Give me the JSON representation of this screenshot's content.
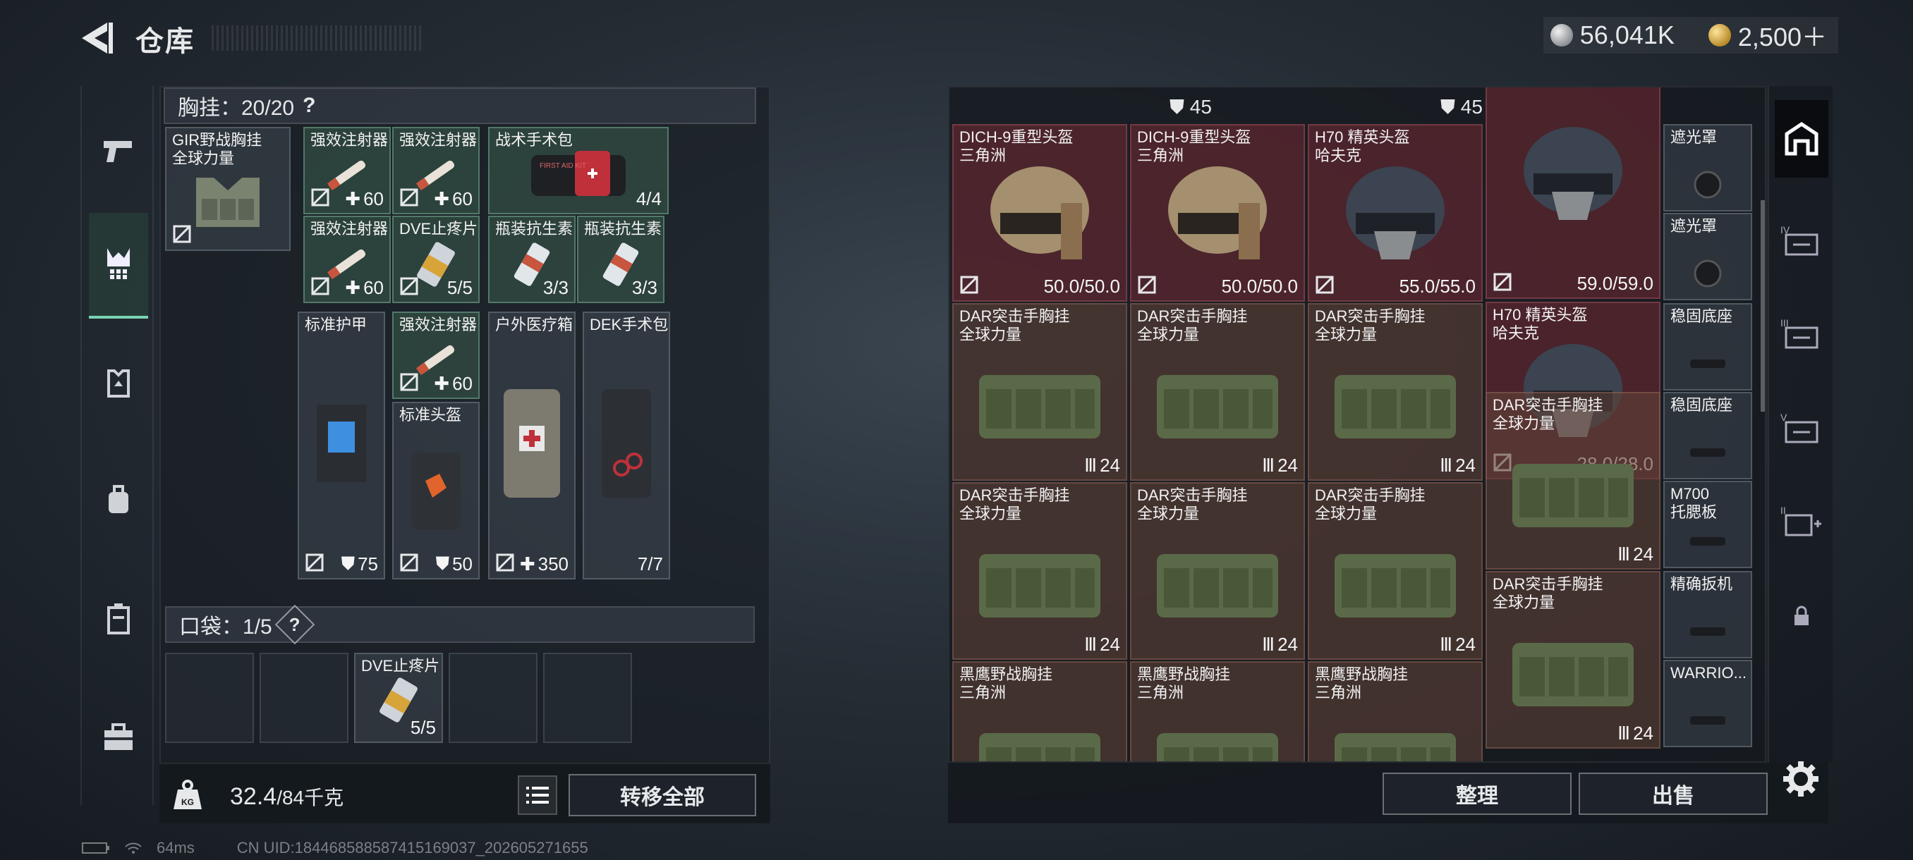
{
  "header": {
    "title": "仓库"
  },
  "currency": {
    "coins": "56,041K",
    "gold": "2,500＋"
  },
  "chest_rig": {
    "label": "胸挂：",
    "count": "20/20",
    "help": "?"
  },
  "pocket": {
    "label": "口袋：",
    "count": "1/5",
    "help": "?"
  },
  "left_items": {
    "rig": {
      "name": "GIR野战胸挂\n全球力量"
    },
    "s1": {
      "name": "强效注射器",
      "value": "60"
    },
    "s2": {
      "name": "强效注射器",
      "value": "60"
    },
    "kit": {
      "name": "战术手术包",
      "value": "4/4",
      "label": "FIRST AID KIT"
    },
    "s3": {
      "name": "强效注射器",
      "value": "60"
    },
    "dve": {
      "name": "DVE止疼片",
      "value": "5/5"
    },
    "ab1": {
      "name": "瓶装抗生素",
      "value": "3/3"
    },
    "ab2": {
      "name": "瓶装抗生素",
      "value": "3/3"
    },
    "armor": {
      "name": "标准护甲",
      "value": "75"
    },
    "s4": {
      "name": "强效注射器",
      "value": "60"
    },
    "helmet": {
      "name": "标准头盔",
      "value": "50"
    },
    "medbox": {
      "name": "户外医疗箱",
      "value": "350"
    },
    "dek": {
      "name": "DEK手术包",
      "value": "7/7"
    },
    "pocket_dve": {
      "name": "DVE止疼片",
      "value": "5/5"
    }
  },
  "weight": {
    "value": "32.4",
    "max": "/84千克",
    "icon_text": "KG"
  },
  "buttons": {
    "transfer_all": "转移全部",
    "organize": "整理",
    "sell": "出售"
  },
  "right_top_values": [
    "45",
    "45"
  ],
  "right_grid": [
    {
      "name": "DICH-9重型头盔\n三角洲",
      "value": "50.0/50.0",
      "color": "red"
    },
    {
      "name": "DICH-9重型头盔\n三角洲",
      "value": "50.0/50.0",
      "color": "red"
    },
    {
      "name": "H70 精英头盔\n哈夫克",
      "value": "55.0/55.0",
      "color": "red"
    },
    {
      "name": "",
      "value": "59.0/59.0",
      "color": "red"
    },
    {
      "name": "H70 精英头盔\n哈夫克",
      "value": "28.0/28.0",
      "color": "red"
    },
    {
      "name": "DAR突击手胸挂\n全球力量",
      "value": "24",
      "color": "brown"
    },
    {
      "name": "DAR突击手胸挂\n全球力量",
      "value": "24",
      "color": "brown"
    },
    {
      "name": "DAR突击手胸挂\n全球力量",
      "value": "24",
      "color": "brown"
    },
    {
      "name": "DAR突击手胸挂\n全球力量",
      "value": "24",
      "color": "brown"
    },
    {
      "name": "DAR突击手胸挂\n全球力量",
      "value": "24",
      "color": "brown"
    },
    {
      "name": "DAR突击手胸挂\n全球力量",
      "value": "24",
      "color": "brown"
    },
    {
      "name": "DAR突击手胸挂\n全球力量",
      "value": "24",
      "color": "brown"
    },
    {
      "name": "DAR突击手胸挂\n全球力量",
      "value": "24",
      "color": "brown"
    },
    {
      "name": "黑鹰野战胸挂\n三角洲",
      "value": "",
      "color": "brown"
    },
    {
      "name": "黑鹰野战胸挂\n三角洲",
      "value": "",
      "color": "brown"
    },
    {
      "name": "黑鹰野战胸挂\n三角洲",
      "value": "",
      "color": "brown"
    }
  ],
  "right_column": [
    {
      "name": "遮光罩"
    },
    {
      "name": "遮光罩"
    },
    {
      "name": "稳固底座"
    },
    {
      "name": "稳固底座"
    },
    {
      "name": "M700\n托腮板"
    },
    {
      "name": "精确扳机"
    },
    {
      "name": "WARRIO..."
    }
  ],
  "status": {
    "ping": "64ms",
    "uid": "CN UID:1844685885874151690​37_202605271655"
  },
  "colors": {
    "accent": "#79d3b4",
    "red_slot": "#6e2832",
    "brown_slot": "#5f4137"
  }
}
